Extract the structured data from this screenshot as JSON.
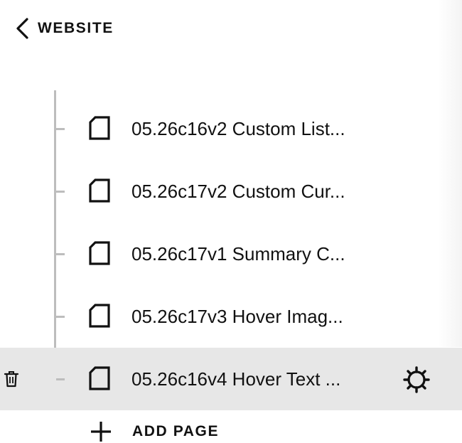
{
  "header": {
    "back_label": "WEBSITE",
    "back_icon": "chevron-left-icon"
  },
  "pages": [
    {
      "title": "05.26c16v2 Custom List...",
      "icon": "page-icon",
      "selected": false
    },
    {
      "title": "05.26c17v2 Custom Cur...",
      "icon": "page-icon",
      "selected": false
    },
    {
      "title": "05.26c17v1 Summary C...",
      "icon": "page-icon",
      "selected": false
    },
    {
      "title": "05.26c17v3 Hover Imag...",
      "icon": "page-icon",
      "selected": false
    },
    {
      "title": "05.26c16v4 Hover Text ...",
      "icon": "page-icon",
      "selected": true,
      "actions": [
        "trash-icon",
        "gear-icon"
      ]
    }
  ],
  "add_page": {
    "label": "ADD PAGE",
    "icon": "plus-icon"
  },
  "colors": {
    "text": "#111111",
    "tree_line": "#bdbdbd",
    "selected_row": "#e7e7e7"
  }
}
